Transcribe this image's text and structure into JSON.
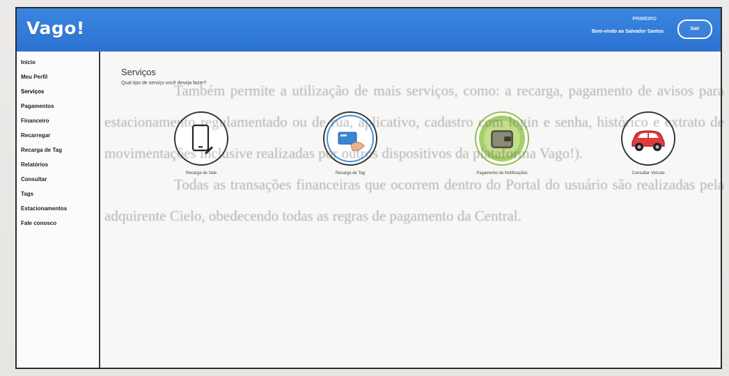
{
  "header": {
    "logo": "Vago!",
    "user_role": "PRIMEIRO",
    "user_name": "Bem-vindo ao Salvador Santos",
    "exit_label": "Sair"
  },
  "sidebar": {
    "items": [
      {
        "label": "Início",
        "active": false
      },
      {
        "label": "Meu Perfil",
        "active": false
      },
      {
        "label": "Serviços",
        "active": true
      },
      {
        "label": "Pagamentos",
        "active": false
      },
      {
        "label": "Financeiro",
        "active": false
      },
      {
        "label": "Recarregar",
        "active": false
      },
      {
        "label": "Recarga de Tag",
        "active": false
      },
      {
        "label": "Relatórios",
        "active": false
      },
      {
        "label": "Consultar",
        "active": false
      },
      {
        "label": "Tags",
        "active": false
      },
      {
        "label": "Estacionamentos",
        "active": false
      },
      {
        "label": "Fale conosco",
        "active": false
      }
    ]
  },
  "main": {
    "title": "Serviços",
    "subtitle": "Qual tipo de serviço você deseja fazer?",
    "services": [
      {
        "label": "Recarga de Vale",
        "icon": "phone-icon"
      },
      {
        "label": "Recarga de Tag",
        "icon": "card-tag-icon"
      },
      {
        "label": "Pagamento de Notificações",
        "icon": "wallet-icon"
      },
      {
        "label": "Consultar Veículo",
        "icon": "car-icon"
      }
    ]
  },
  "background_text": {
    "line1": "Também permite a utilização de mais serviços, como: a recarga, pagamento de avisos para estacionamento regulamentado ou de rua, aplicativo, cadastro com login e senha, histórico e extrato de movimentações inclusive realizadas por outros dispositivos da plataforma Vago!).",
    "line2": "Todas as transações financeiras que ocorrem dentro do Portal do usuário são realizadas pela adquirente Cielo, obedecendo todas as regras de pagamento da Central."
  },
  "colors": {
    "header": "#2b72d0",
    "wallet_circle": "#a8ce6a",
    "tag_circle": "#4b8fd6",
    "car": "#e03c3c"
  }
}
